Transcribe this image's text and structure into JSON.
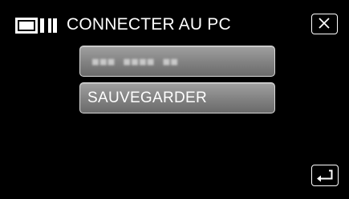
{
  "header": {
    "icon": "computer-monitor-icon",
    "title": "CONNECTER AU PC"
  },
  "close_button": {
    "icon": "close-icon"
  },
  "menu": {
    "items": [
      {
        "label": "",
        "obscured_text": "■■■ ■■■■ ■■"
      },
      {
        "label": "SAUVEGARDER"
      }
    ]
  },
  "back_button": {
    "icon": "return-arrow-icon"
  },
  "colors": {
    "background": "#000000",
    "button_gradient_top": "#a0a0a0",
    "button_gradient_bottom": "#6a6a6a",
    "text": "#ffffff"
  }
}
